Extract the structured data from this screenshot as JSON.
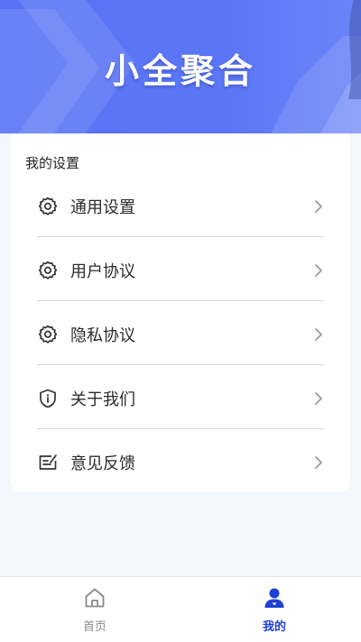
{
  "banner": {
    "title": "小全聚合"
  },
  "settings": {
    "header": "我的设置",
    "items": [
      {
        "label": "通用设置",
        "icon": "gear-icon"
      },
      {
        "label": "用户协议",
        "icon": "gear-icon"
      },
      {
        "label": "隐私协议",
        "icon": "gear-icon"
      },
      {
        "label": "关于我们",
        "icon": "shield-info-icon"
      },
      {
        "label": "意见反馈",
        "icon": "feedback-icon"
      }
    ]
  },
  "tabbar": {
    "tabs": [
      {
        "label": "首页",
        "icon": "home-icon",
        "active": false
      },
      {
        "label": "我的",
        "icon": "user-icon",
        "active": true
      }
    ],
    "active_color": "#1f3fd6",
    "inactive_color": "#8a8a8a"
  },
  "colors": {
    "banner": "#5873f5",
    "background": "#f4f7fb"
  }
}
